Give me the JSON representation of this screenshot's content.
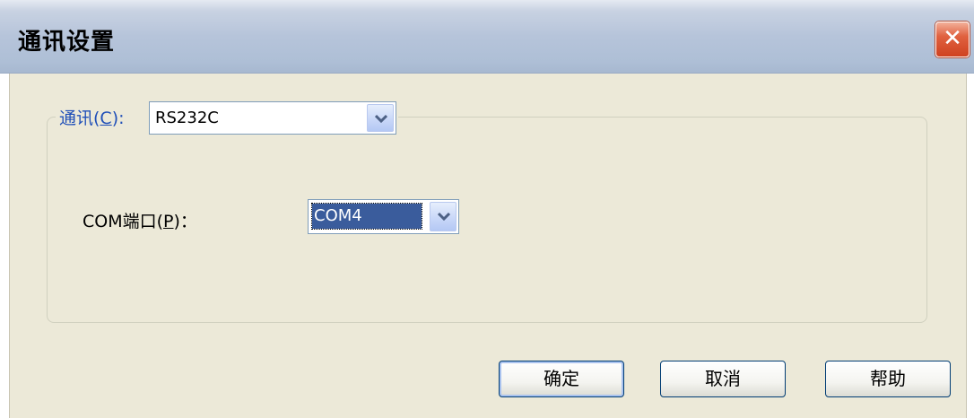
{
  "window": {
    "title": "通讯设置",
    "close_glyph": "✕"
  },
  "comm": {
    "label": "通讯(",
    "accel": "C",
    "label_end": "):",
    "value": "RS232C"
  },
  "port": {
    "label": "COM端口(",
    "accel": "P",
    "label_end": ")：",
    "value": "COM4"
  },
  "buttons": {
    "ok": "确定",
    "cancel": "取消",
    "help": "帮助"
  },
  "icons": {
    "dropdown": "chevron-down-icon",
    "close": "close-icon"
  }
}
